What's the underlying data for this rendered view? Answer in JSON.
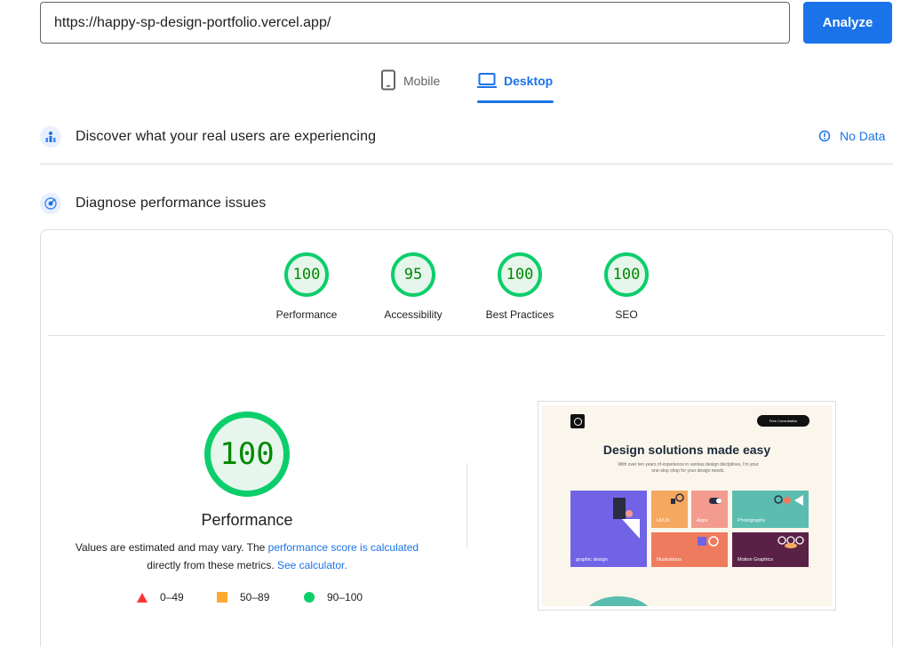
{
  "search": {
    "url": "https://happy-sp-design-portfolio.vercel.app/",
    "analyze_label": "Analyze"
  },
  "tabs": {
    "mobile": "Mobile",
    "desktop": "Desktop",
    "active": "desktop"
  },
  "field_data": {
    "title": "Discover what your real users are experiencing",
    "status": "No Data"
  },
  "lab_data": {
    "title": "Diagnose performance issues"
  },
  "scores": [
    {
      "label": "Performance",
      "value": "100"
    },
    {
      "label": "Accessibility",
      "value": "95"
    },
    {
      "label": "Best Practices",
      "value": "100"
    },
    {
      "label": "SEO",
      "value": "100"
    }
  ],
  "performance": {
    "score": "100",
    "title": "Performance",
    "desc_prefix": "Values are estimated and may vary. The ",
    "desc_link1": "performance score is calculated",
    "desc_mid": " directly from these metrics. ",
    "desc_link2": "See calculator."
  },
  "legend": [
    {
      "range": "0–49",
      "color": "#ff3333",
      "shape": "triangle"
    },
    {
      "range": "50–89",
      "color": "#ffaa33",
      "shape": "square"
    },
    {
      "range": "90–100",
      "color": "#0cce6b",
      "shape": "circle"
    }
  ],
  "thumbnail": {
    "cta": "Free Consultation",
    "headline": "Design solutions made easy",
    "subtext": "With over ten years of experience in various design disciplines, I'm your one-stop shop for your design needs.",
    "tiles": [
      {
        "label": "graphic design",
        "color": "#7063e6"
      },
      {
        "label": "UI/UX",
        "color": "#f5a85f"
      },
      {
        "label": "Apps",
        "color": "#f39b8e"
      },
      {
        "label": "Photography",
        "color": "#5bbdb0"
      },
      {
        "label": "Illustrations",
        "color": "#ef7b5e"
      },
      {
        "label": "Motion Graphics",
        "color": "#5a2146"
      }
    ]
  }
}
